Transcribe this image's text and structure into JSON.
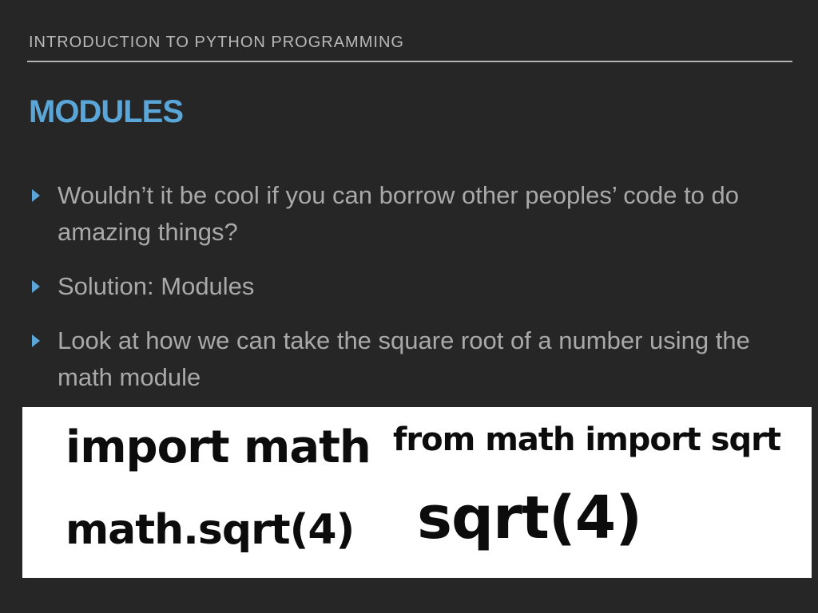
{
  "slide": {
    "header": "INTRODUCTION TO PYTHON PROGRAMMING",
    "title": "MODULES",
    "bullets": [
      "Wouldn’t it be cool if you can borrow other peoples’ code to do amazing things?",
      "Solution: Modules",
      "Look at how we can take the square root of a number using the math module"
    ]
  },
  "code_examples": {
    "left": [
      "import math",
      "math.sqrt(4)"
    ],
    "right": [
      "from math import sqrt",
      "sqrt(4)"
    ]
  },
  "colors": {
    "background": "#262626",
    "accent": "#5aa6d8",
    "body_text": "#a9a9a9",
    "header_text": "#b9b9b9",
    "code_panel": "#ffffff",
    "code_text": "#0c0c0c"
  }
}
